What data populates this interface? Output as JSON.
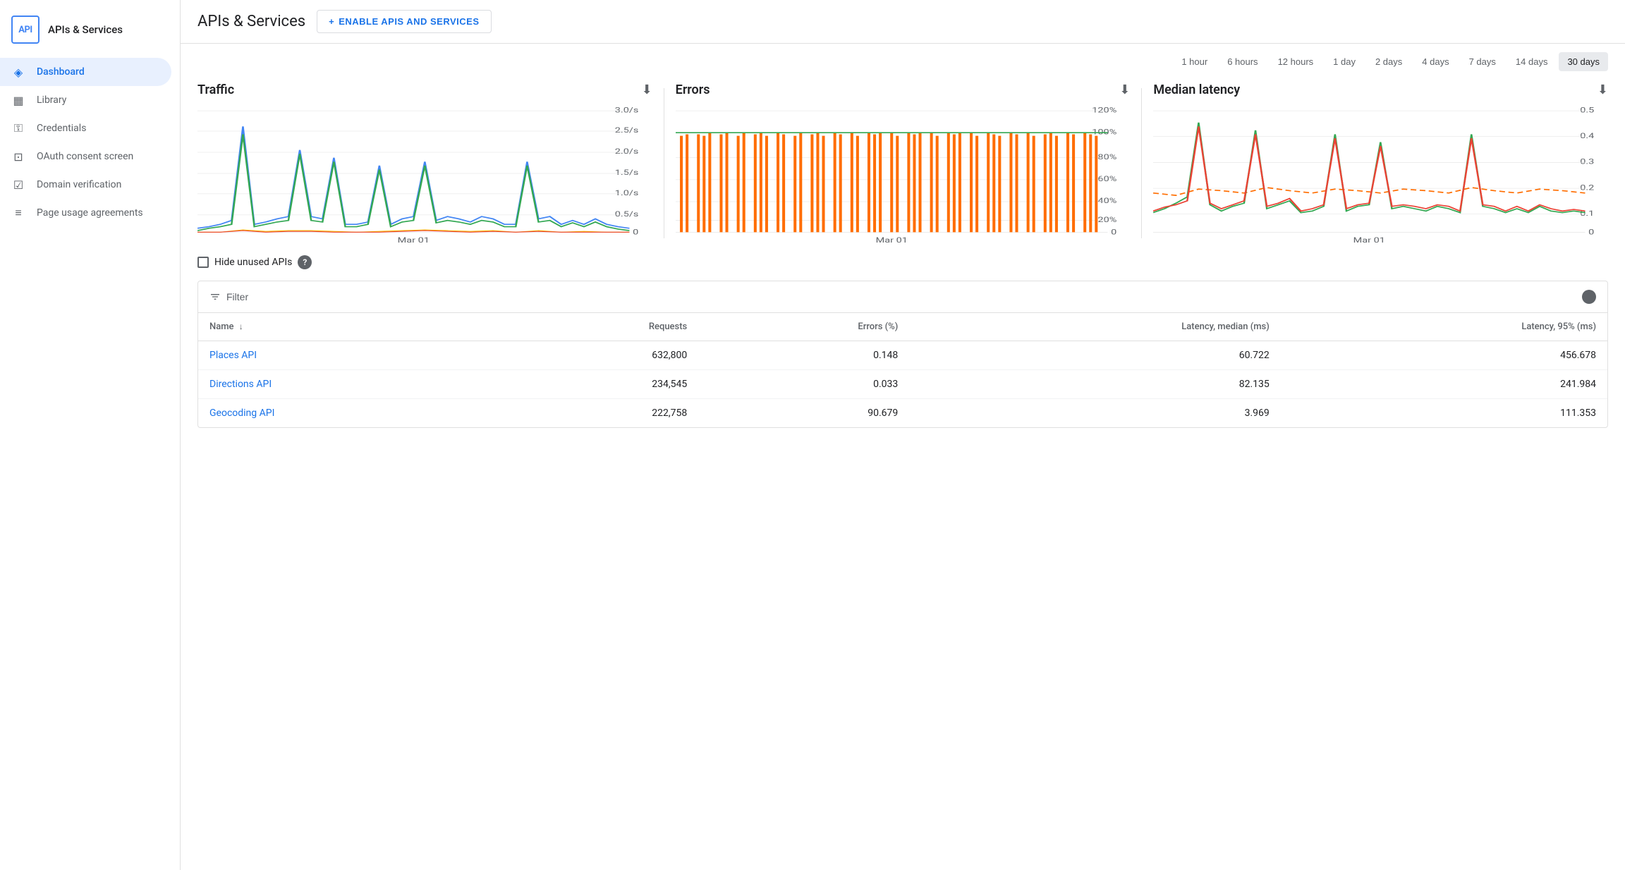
{
  "sidebar": {
    "logo_text": "API",
    "title": "APIs & Services",
    "nav_items": [
      {
        "id": "dashboard",
        "label": "Dashboard",
        "icon": "◈",
        "active": true
      },
      {
        "id": "library",
        "label": "Library",
        "icon": "▦",
        "active": false
      },
      {
        "id": "credentials",
        "label": "Credentials",
        "icon": "⚿",
        "active": false
      },
      {
        "id": "oauth",
        "label": "OAuth consent screen",
        "icon": "⊡",
        "active": false
      },
      {
        "id": "domain",
        "label": "Domain verification",
        "icon": "☑",
        "active": false
      },
      {
        "id": "page-usage",
        "label": "Page usage agreements",
        "icon": "≡",
        "active": false
      }
    ]
  },
  "header": {
    "title": "APIs & Services",
    "enable_button": "ENABLE APIS AND SERVICES"
  },
  "time_filters": [
    {
      "label": "1 hour",
      "active": false
    },
    {
      "label": "6 hours",
      "active": false
    },
    {
      "label": "12 hours",
      "active": false
    },
    {
      "label": "1 day",
      "active": false
    },
    {
      "label": "2 days",
      "active": false
    },
    {
      "label": "4 days",
      "active": false
    },
    {
      "label": "7 days",
      "active": false
    },
    {
      "label": "14 days",
      "active": false
    },
    {
      "label": "30 days",
      "active": true
    }
  ],
  "charts": {
    "traffic": {
      "title": "Traffic",
      "x_label": "Mar 01"
    },
    "errors": {
      "title": "Errors",
      "x_label": "Mar 01"
    },
    "latency": {
      "title": "Median latency",
      "x_label": "Mar 01"
    }
  },
  "hide_unused": {
    "label": "Hide unused APIs"
  },
  "table": {
    "filter_label": "Filter",
    "columns": [
      "Name",
      "Requests",
      "Errors (%)",
      "Latency, median (ms)",
      "Latency, 95% (ms)"
    ],
    "rows": [
      {
        "name": "Places API",
        "requests": "632,800",
        "errors": "0.148",
        "latency_median": "60.722",
        "latency_95": "456.678"
      },
      {
        "name": "Directions API",
        "requests": "234,545",
        "errors": "0.033",
        "latency_median": "82.135",
        "latency_95": "241.984"
      },
      {
        "name": "Geocoding API",
        "requests": "222,758",
        "errors": "90.679",
        "latency_median": "3.969",
        "latency_95": "111.353"
      }
    ]
  }
}
